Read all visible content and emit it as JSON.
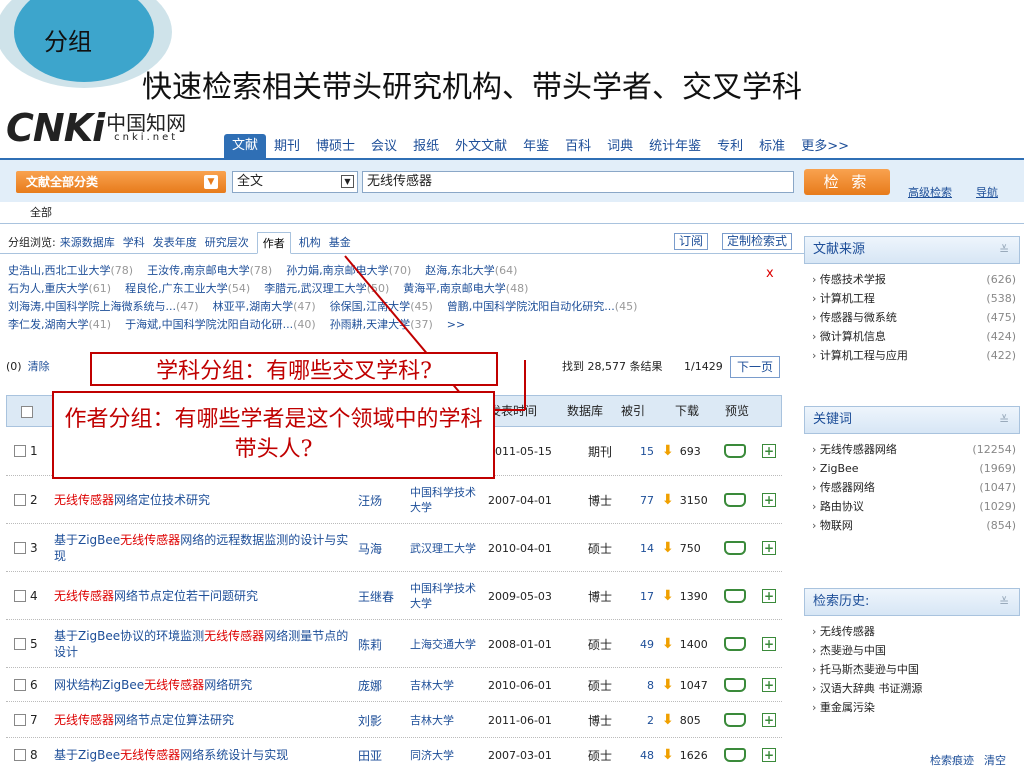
{
  "slide": {
    "label": "分组",
    "title": "快速检索相关带头研究机构、带头学者、交叉学科"
  },
  "logo": {
    "main": "CNKi",
    "cn": "中国知网",
    "en": "cnki.net"
  },
  "nav": [
    "文献",
    "期刊",
    "博硕士",
    "会议",
    "报纸",
    "外文文献",
    "年鉴",
    "百科",
    "词典",
    "统计年鉴",
    "专利",
    "标准",
    "更多>>"
  ],
  "search": {
    "category": "文献全部分类",
    "field": "全文",
    "query": "无线传感器",
    "button": "检 索",
    "advanced": "高级检索",
    "navigate": "导航"
  },
  "all_label": "全部",
  "group": {
    "label": "分组浏览:",
    "items": [
      "来源数据库",
      "学科",
      "发表年度",
      "研究层次",
      "作者",
      "机构",
      "基金"
    ],
    "subscribe": "订阅",
    "custom": "定制检索式"
  },
  "authors": [
    [
      {
        "n": "史浩山,西北工业大学",
        "c": "(78)"
      },
      {
        "n": "王汝传,南京邮电大学",
        "c": "(78)"
      },
      {
        "n": "孙力娟,南京邮电大学",
        "c": "(70)"
      },
      {
        "n": "赵海,东北大学",
        "c": "(64)"
      }
    ],
    [
      {
        "n": "石为人,重庆大学",
        "c": "(61)"
      },
      {
        "n": "程良伦,广东工业大学",
        "c": "(54)"
      },
      {
        "n": "李腊元,武汉理工大学",
        "c": "(50)"
      },
      {
        "n": "黄海平,南京邮电大学",
        "c": "(48)"
      }
    ],
    [
      {
        "n": "刘海涛,中国科学院上海微系统与...",
        "c": "(47)"
      },
      {
        "n": "林亚平,湖南大学",
        "c": "(47)"
      },
      {
        "n": "徐保国,江南大学",
        "c": "(45)"
      },
      {
        "n": "曾鹏,中国科学院沈阳自动化研究...",
        "c": "(45)"
      }
    ],
    [
      {
        "n": "李仁发,湖南大学",
        "c": "(41)"
      },
      {
        "n": "于海斌,中国科学院沈阳自动化研...",
        "c": "(40)"
      },
      {
        "n": "孙雨耕,天津大学",
        "c": "(37)"
      },
      {
        "n": ">>",
        "c": ""
      }
    ]
  ],
  "close": "x",
  "toolbar": {
    "count": "(0)",
    "clear": "清除",
    "result_prefix": "找到",
    "result_num": "28,577",
    "result_suffix": "条结果",
    "pages": "1/1429",
    "next": "下一页"
  },
  "columns": {
    "date": "发表时间",
    "db": "数据库",
    "cite": "被引",
    "download": "下载",
    "preview": "预览"
  },
  "rows": [
    {
      "n": "1",
      "t": [],
      "a": "",
      "s": "",
      "d": "2011-05-15",
      "db": "期刊",
      "c": "15",
      "dl": "693"
    },
    {
      "n": "2",
      "t": [
        {
          "h": true,
          "x": "无线传感器"
        },
        {
          "h": false,
          "x": "网络定位技术研究"
        }
      ],
      "a": "汪炀",
      "s": "中国科学技术大学",
      "d": "2007-04-01",
      "db": "博士",
      "c": "77",
      "dl": "3150"
    },
    {
      "n": "3",
      "t": [
        {
          "h": false,
          "x": "基于ZigBee"
        },
        {
          "h": true,
          "x": "无线传感器"
        },
        {
          "h": false,
          "x": "网络的远程数据监测的设计与实现"
        }
      ],
      "a": "马海",
      "s": "武汉理工大学",
      "d": "2010-04-01",
      "db": "硕士",
      "c": "14",
      "dl": "750"
    },
    {
      "n": "4",
      "t": [
        {
          "h": true,
          "x": "无线传感器"
        },
        {
          "h": false,
          "x": "网络节点定位若干问题研究"
        }
      ],
      "a": "王继春",
      "s": "中国科学技术大学",
      "d": "2009-05-03",
      "db": "博士",
      "c": "17",
      "dl": "1390"
    },
    {
      "n": "5",
      "t": [
        {
          "h": false,
          "x": "基于ZigBee协议的环境监测"
        },
        {
          "h": true,
          "x": "无线传感器"
        },
        {
          "h": false,
          "x": "网络测量节点的设计"
        }
      ],
      "a": "陈莉",
      "s": "上海交通大学",
      "d": "2008-01-01",
      "db": "硕士",
      "c": "49",
      "dl": "1400"
    },
    {
      "n": "6",
      "t": [
        {
          "h": false,
          "x": "网状结构ZigBee"
        },
        {
          "h": true,
          "x": "无线传感器"
        },
        {
          "h": false,
          "x": "网络研究"
        }
      ],
      "a": "庞娜",
      "s": "吉林大学",
      "d": "2010-06-01",
      "db": "硕士",
      "c": "8",
      "dl": "1047"
    },
    {
      "n": "7",
      "t": [
        {
          "h": true,
          "x": "无线传感器"
        },
        {
          "h": false,
          "x": "网络节点定位算法研究"
        }
      ],
      "a": "刘影",
      "s": "吉林大学",
      "d": "2011-06-01",
      "db": "博士",
      "c": "2",
      "dl": "805"
    },
    {
      "n": "8",
      "t": [
        {
          "h": false,
          "x": "基于ZigBee"
        },
        {
          "h": true,
          "x": "无线传感器"
        },
        {
          "h": false,
          "x": "网络系统设计与实现"
        }
      ],
      "a": "田亚",
      "s": "同济大学",
      "d": "2007-03-01",
      "db": "硕士",
      "c": "48",
      "dl": "1626"
    }
  ],
  "annotations": {
    "subject": "学科分组：有哪些交叉学科?",
    "author": "作者分组：有哪些学者是这个领域中的学科带头人?"
  },
  "sidebar": {
    "source": {
      "title": "文献来源",
      "items": [
        {
          "n": "传感技术学报",
          "c": "(626)"
        },
        {
          "n": "计算机工程",
          "c": "(538)"
        },
        {
          "n": "传感器与微系统",
          "c": "(475)"
        },
        {
          "n": "微计算机信息",
          "c": "(424)"
        },
        {
          "n": "计算机工程与应用",
          "c": "(422)"
        }
      ]
    },
    "keywords": {
      "title": "关键词",
      "items": [
        {
          "n": "无线传感器网络",
          "c": "(12254)"
        },
        {
          "n": "ZigBee",
          "c": "(1969)"
        },
        {
          "n": "传感器网络",
          "c": "(1047)"
        },
        {
          "n": "路由协议",
          "c": "(1029)"
        },
        {
          "n": "物联网",
          "c": "(854)"
        }
      ]
    },
    "history": {
      "title": "检索历史:",
      "items": [
        "无线传感器",
        "杰斐逊与中国",
        "托马斯杰斐逊与中国",
        "汉语大辞典 书证溯源",
        "重金属污染"
      ],
      "trace": "检索痕迹",
      "clear": "清空"
    }
  }
}
